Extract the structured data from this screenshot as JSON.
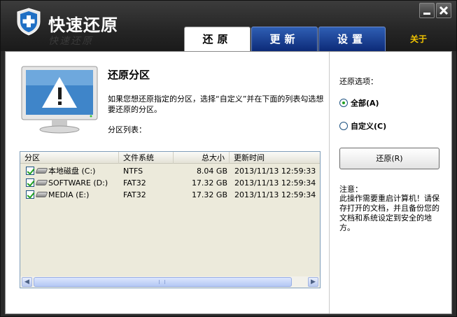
{
  "header": {
    "title": "快速还原",
    "shadow_text": "快速还原",
    "tabs": [
      {
        "label": "还原",
        "active": true
      },
      {
        "label": "更新",
        "active": false
      },
      {
        "label": "设置",
        "active": false
      }
    ],
    "about_label": "关于"
  },
  "main": {
    "section_title": "还原分区",
    "description": "如果您想还原指定的分区，选择“自定义”并在下面的列表勾选想要还原的分区。",
    "partition_list_label": "分区列表：",
    "columns": [
      "分区",
      "文件系统",
      "总大小",
      "更新时间"
    ],
    "rows": [
      {
        "name": "本地磁盘 (C:)",
        "fs": "NTFS",
        "size": "8.04 GB",
        "time": "2013/11/13 12:59:33",
        "checked": true
      },
      {
        "name": "SOFTWARE (D:)",
        "fs": "FAT32",
        "size": "17.32 GB",
        "time": "2013/11/13 12:59:34",
        "checked": true
      },
      {
        "name": "MEDIA (E:)",
        "fs": "FAT32",
        "size": "17.32 GB",
        "time": "2013/11/13 12:59:34",
        "checked": true
      }
    ]
  },
  "options": {
    "title": "还原选项：",
    "all_label": "全部(A)",
    "custom_label": "自定义(C)",
    "selected": "all",
    "restore_button": "还原(R)",
    "note_title": "注意：",
    "note_body": "此操作需要重启计算机！请保存打开的文档，并且备份您的文档和系统设定到安全的地方。"
  },
  "colors": {
    "tab_active_bg": "#ffffff",
    "tab_inactive_bg": "#1f4a9e",
    "about_color": "#f2c400",
    "check_green": "#21a121"
  }
}
